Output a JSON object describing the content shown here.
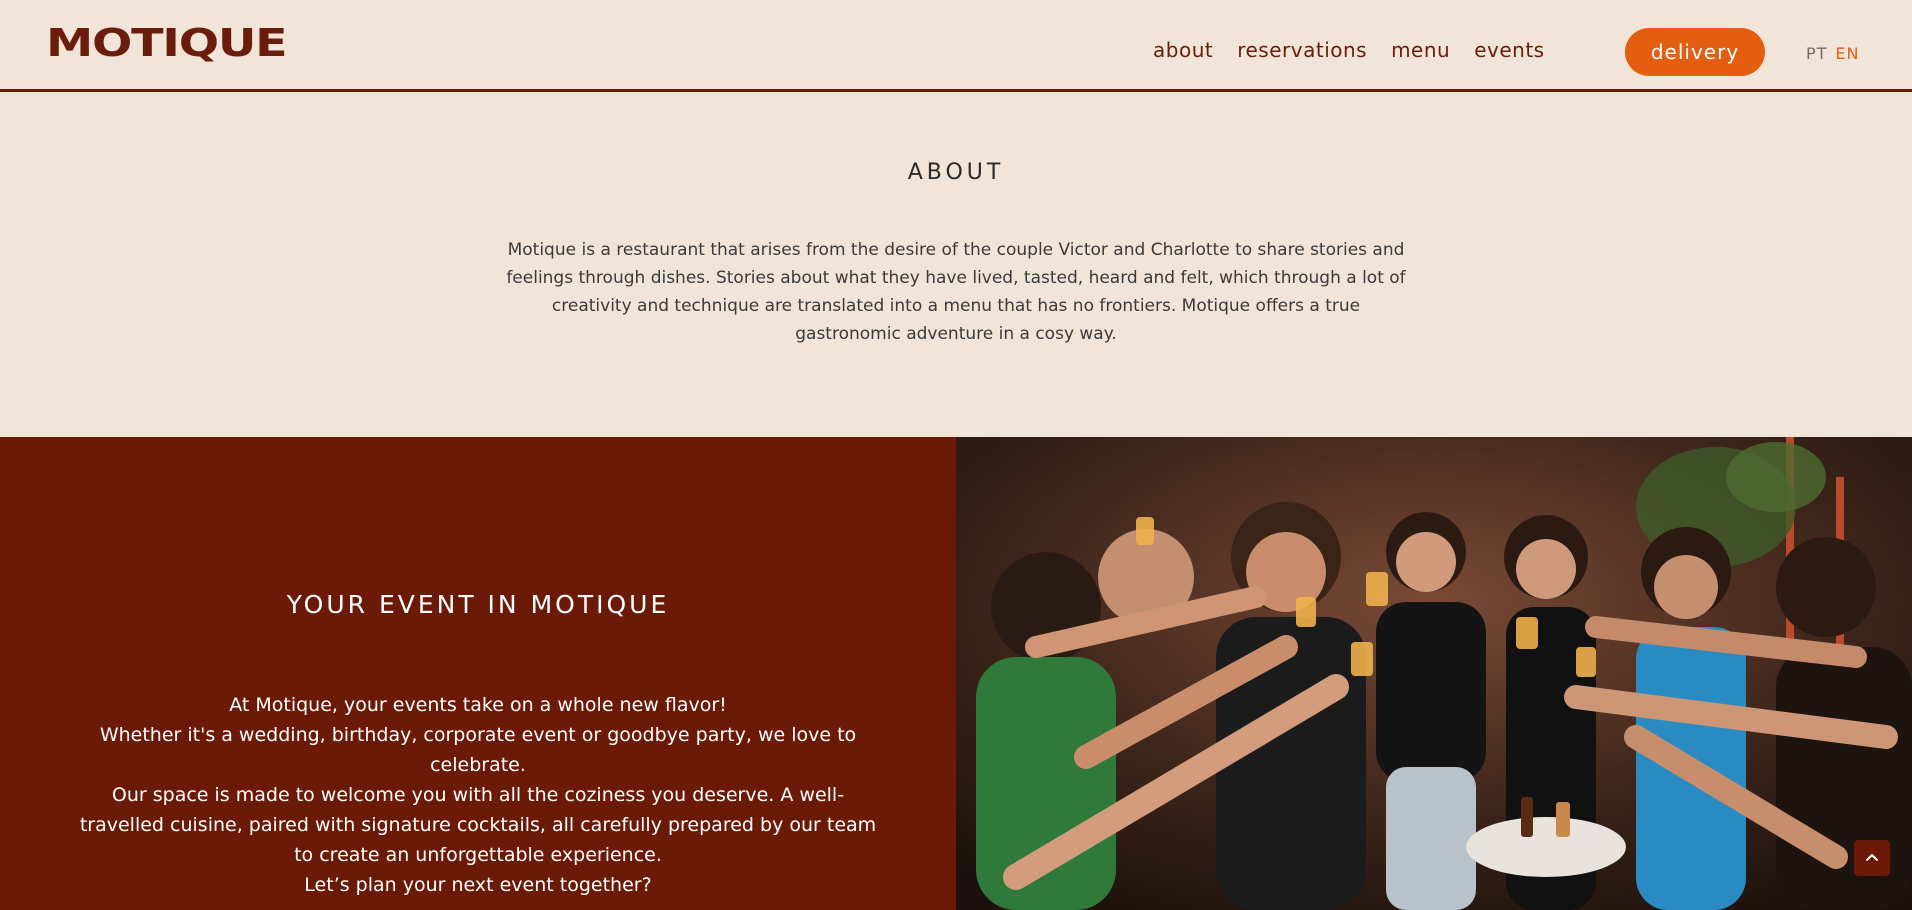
{
  "header": {
    "logo_text": "MOTIQUE",
    "nav": [
      "about",
      "reservations",
      "menu",
      "events"
    ],
    "delivery_label": "delivery",
    "lang": {
      "pt": "PT",
      "en": "EN"
    }
  },
  "about": {
    "title": "ABOUT",
    "lines": [
      "Motique is a restaurant that arises from the desire of the couple Victor and Charlotte to share stories and",
      "feelings through dishes. Stories about what they have lived, tasted, heard and felt, which through a lot of",
      "creativity and technique are translated into a menu that has no frontiers. Motique offers a true",
      "gastronomic adventure in a cosy way."
    ]
  },
  "events": {
    "title": "YOUR EVENT IN MOTIQUE",
    "lines": [
      "At Motique, your events take on a whole new flavor!",
      "Whether it's a wedding, birthday, corporate event or goodbye party, we love to",
      "celebrate.",
      "Our space is made to welcome you with all the coziness you deserve. A well-",
      "travelled cuisine, paired with signature cocktails, all carefully prepared by our team",
      "to create an unforgettable experience.",
      "Let’s plan your next event together?"
    ]
  },
  "colors": {
    "accent": "#e35e10",
    "brand": "#6b1d0b",
    "background": "#f1e4d8"
  },
  "icons": {
    "scroll_top": "chevron-up-icon"
  }
}
